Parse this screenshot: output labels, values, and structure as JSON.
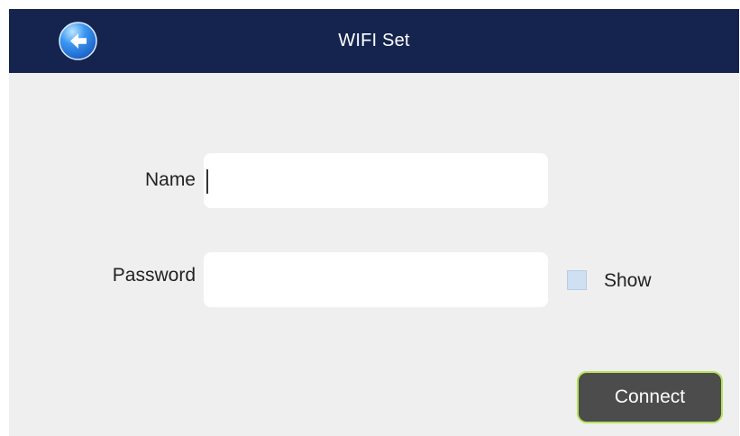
{
  "header": {
    "title": "WIFI Set",
    "back_icon": "back-arrow-icon",
    "background_color": "#15244f"
  },
  "form": {
    "name_label": "Name",
    "name_value": "",
    "password_label": "Password",
    "password_value": "",
    "show_label": "Show",
    "show_checked": false
  },
  "actions": {
    "connect_label": "Connect"
  },
  "colors": {
    "page_background": "#efefef",
    "field_background": "#ffffff",
    "button_background": "#4c4c4c",
    "button_border": "#b6e05a",
    "checkbox_fill": "#cfe0f3"
  }
}
